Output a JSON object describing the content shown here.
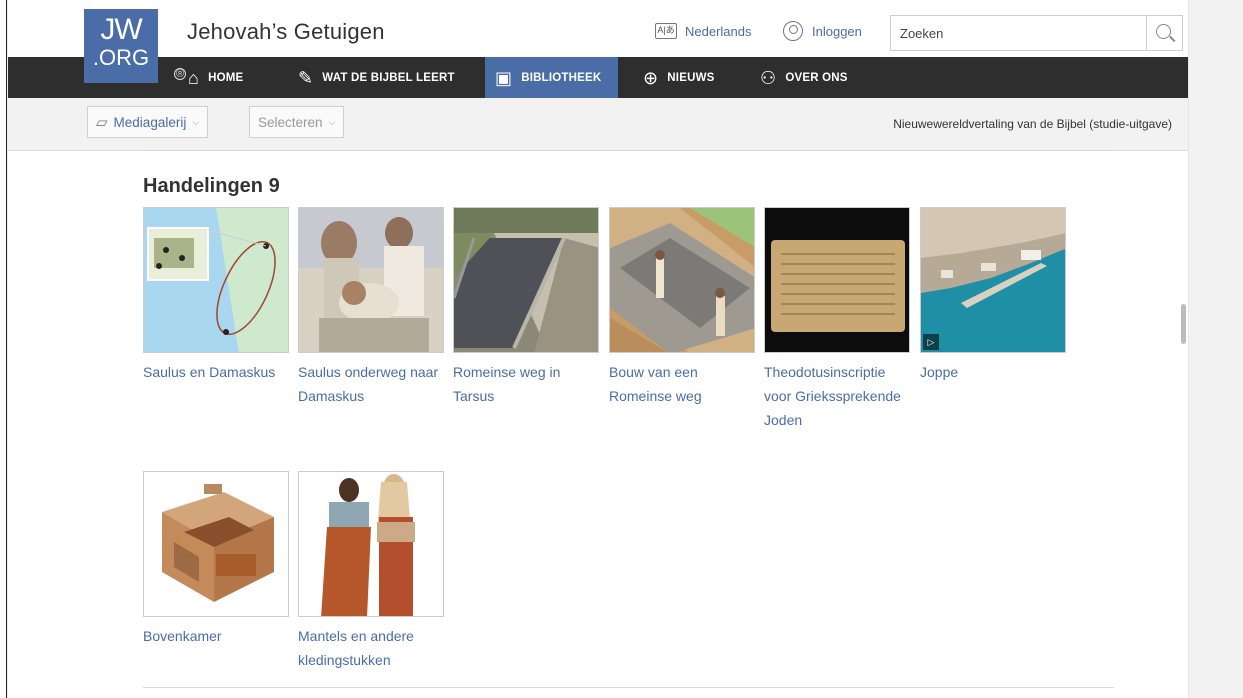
{
  "header": {
    "logo_top": "JW",
    "logo_bottom": ".ORG",
    "site_title": "Jehovah’s Getuigen",
    "language_label": "Nederlands",
    "login_label": "Inloggen",
    "search_placeholder": "Zoeken"
  },
  "nav": {
    "items": [
      {
        "label": "HOME",
        "icon": "home-icon"
      },
      {
        "label": "WAT DE BIJBEL LEERT",
        "icon": "bible-icon"
      },
      {
        "label": "BIBLIOTHEEK",
        "icon": "library-icon",
        "active": true
      },
      {
        "label": "NIEUWS",
        "icon": "globe-icon"
      },
      {
        "label": "OVER ONS",
        "icon": "people-icon"
      }
    ]
  },
  "toolbar": {
    "media_gallery_label": "Mediagalerij",
    "select_label": "Selecteren",
    "publication": "Nieuwewereldvertaling van de Bijbel (studie-uitgave)"
  },
  "content": {
    "heading": "Handelingen 9",
    "items": [
      {
        "caption": "Saulus en Damaskus"
      },
      {
        "caption": "Saulus onderweg naar Damaskus"
      },
      {
        "caption": "Romeinse weg in Tarsus"
      },
      {
        "caption": "Bouw van een Romeinse weg"
      },
      {
        "caption": "Theodotusinscriptie voor Griekssprekende Joden"
      },
      {
        "caption": "Joppe",
        "has_video": true
      },
      {
        "caption": "Bovenkamer"
      },
      {
        "caption": "Mantels en andere kledingstukken"
      }
    ]
  },
  "colors": {
    "brand": "#4a6da7",
    "navbar": "#2e2e2e"
  }
}
